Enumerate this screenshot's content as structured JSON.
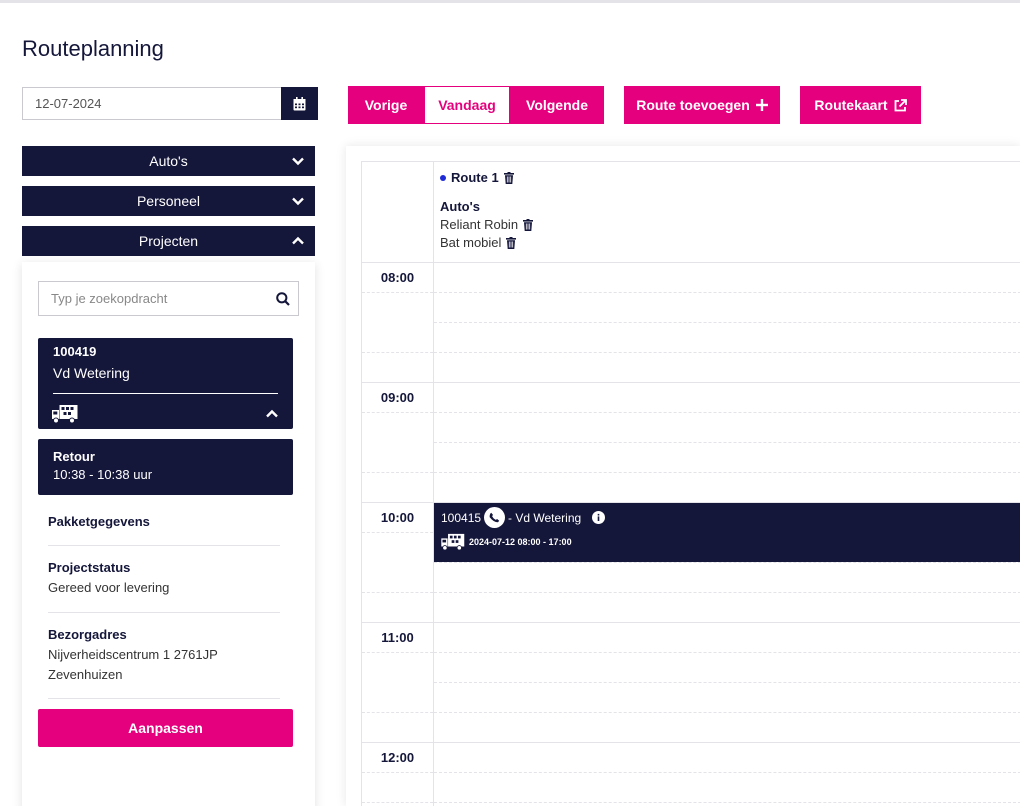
{
  "page": {
    "title": "Routeplanning"
  },
  "date": {
    "value": "12-07-2024"
  },
  "toolbar": {
    "prev_label": "Vorige",
    "today_label": "Vandaag",
    "next_label": "Volgende",
    "add_route_label": "Route toevoegen",
    "routemap_label": "Routekaart"
  },
  "sidebar": {
    "autos_label": "Auto's",
    "personnel_label": "Personeel",
    "projects_label": "Projecten",
    "search_placeholder": "Typ je zoekopdracht",
    "project": {
      "number": "100419",
      "name": "Vd Wetering",
      "retour_label": "Retour",
      "retour_time": "10:38 - 10:38 uur"
    },
    "details": {
      "package_heading": "Pakketgegevens",
      "status_heading": "Projectstatus",
      "status_value": "Gereed voor levering",
      "address_heading": "Bezorgadres",
      "address_line1": "Nijverheidscentrum 1 2761JP",
      "address_line2": "Zevenhuizen"
    },
    "edit_label": "Aanpassen"
  },
  "calendar": {
    "route_name": "Route 1",
    "autos_heading": "Auto's",
    "cars": [
      "Reliant Robin",
      "Bat mobiel"
    ],
    "hours": [
      "08:00",
      "09:00",
      "10:00",
      "11:00",
      "12:00"
    ],
    "event": {
      "number": "100415",
      "name": "- Vd Wetering",
      "datetime": "2024-07-12 08:00 - 17:00"
    }
  },
  "colors": {
    "primary": "#e5007e",
    "navy": "#14163a",
    "route_dot": "#1e2bd6"
  },
  "icons": [
    "calendar-icon",
    "plus-icon",
    "external-link-icon",
    "chevron-down-icon",
    "chevron-up-icon",
    "search-icon",
    "truck-icon",
    "trash-icon",
    "phone-icon",
    "info-icon"
  ]
}
